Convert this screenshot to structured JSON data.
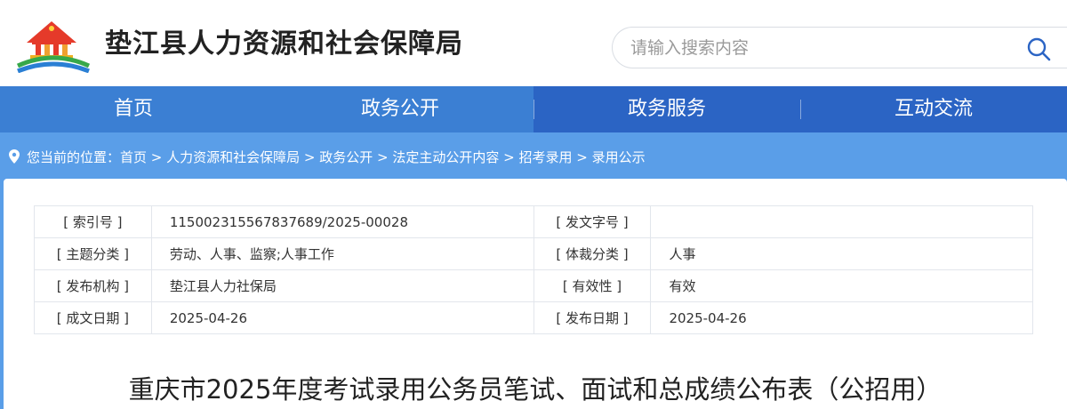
{
  "header": {
    "site_title": "垫江县人力资源和社会保障局",
    "logo_icon": "government-building-logo-icon",
    "search": {
      "placeholder": "请输入搜索内容",
      "icon": "search-icon"
    }
  },
  "nav": {
    "items": [
      {
        "label": "首页"
      },
      {
        "label": "政务公开"
      },
      {
        "label": "政务服务"
      },
      {
        "label": "互动交流"
      }
    ]
  },
  "breadcrumb": {
    "icon": "location-pin-icon",
    "prefix": "您当前的位置：",
    "items": [
      "首页",
      "人力资源和社会保障局",
      "政务公开",
      "法定主动公开内容",
      "招考录用",
      "录用公示"
    ],
    "separator": " > "
  },
  "meta": {
    "rows": [
      {
        "l1": "[ 索引号 ]",
        "v1": "115002315567837689/2025-00028",
        "l2": "[ 发文字号 ]",
        "v2": ""
      },
      {
        "l1": "[ 主题分类 ]",
        "v1": "劳动、人事、监察;人事工作",
        "l2": "[ 体裁分类 ]",
        "v2": "人事"
      },
      {
        "l1": "[ 发布机构 ]",
        "v1": "垫江县人力社保局",
        "l2": "[ 有效性 ]",
        "v2": "有效"
      },
      {
        "l1": "[ 成文日期 ]",
        "v1": "2025-04-26",
        "l2": "[ 发布日期 ]",
        "v2": "2025-04-26"
      }
    ]
  },
  "document": {
    "title": "重庆市2025年度考试录用公务员笔试、面试和总成绩公布表（公招用）"
  },
  "colors": {
    "nav_bg": "#2b64c4",
    "nav_active": "#3b7fd3",
    "breadcrumb_bg": "#5a9ee8",
    "accent_blue": "#2b64c4"
  }
}
